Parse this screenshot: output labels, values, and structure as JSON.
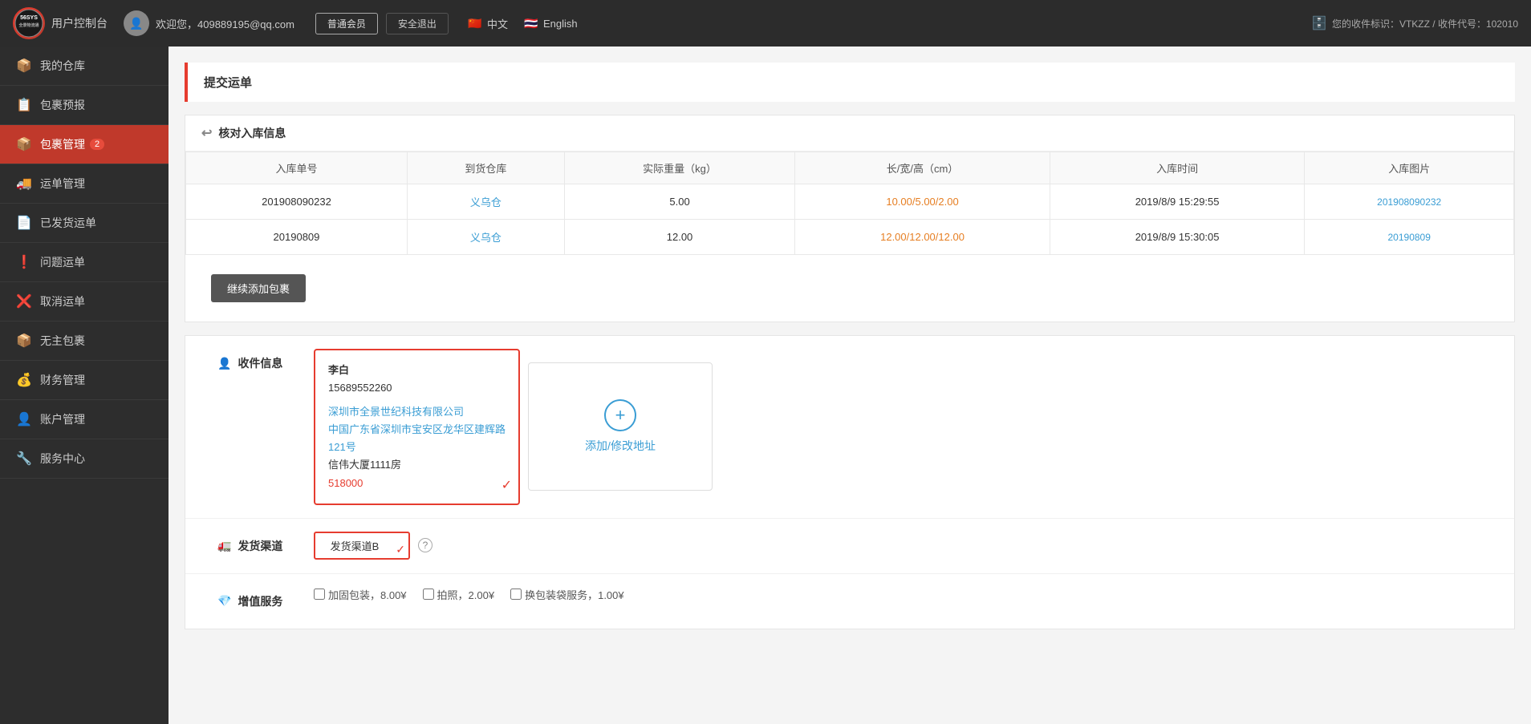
{
  "header": {
    "logo_text": "56SYS",
    "logo_sub": "全景物流通",
    "control_label": "用户控制台",
    "welcome_text": "欢迎您，409889195@qq.com",
    "member_label": "普通会员",
    "logout_label": "安全退出",
    "lang_cn": "中文",
    "lang_en": "English",
    "receipt_label": "您的收件标识：VTKZZ / 收件代号：102010"
  },
  "sidebar": {
    "items": [
      {
        "label": "我的仓库",
        "icon": "📦",
        "active": false
      },
      {
        "label": "包裹预报",
        "icon": "📋",
        "active": false
      },
      {
        "label": "包裹管理",
        "icon": "📦",
        "active": true,
        "badge": "2"
      },
      {
        "label": "运单管理",
        "icon": "🚚",
        "active": false
      },
      {
        "label": "已发货运单",
        "icon": "📄",
        "active": false
      },
      {
        "label": "问题运单",
        "icon": "❗",
        "active": false
      },
      {
        "label": "取消运单",
        "icon": "❌",
        "active": false
      },
      {
        "label": "无主包裹",
        "icon": "📦",
        "active": false
      },
      {
        "label": "财务管理",
        "icon": "💰",
        "active": false
      },
      {
        "label": "账户管理",
        "icon": "👤",
        "active": false
      },
      {
        "label": "服务中心",
        "icon": "🔧",
        "active": false
      }
    ]
  },
  "page": {
    "title": "提交运单",
    "section_verify": "核对入库信息",
    "section_address": "收件信息",
    "section_channel": "发货渠道",
    "section_value": "增值服务"
  },
  "table": {
    "headers": [
      "入库单号",
      "到货仓库",
      "实际重量（kg）",
      "长/宽/高（cm）",
      "入库时间",
      "入库图片"
    ],
    "rows": [
      {
        "order_no": "201908090232",
        "warehouse": "义乌仓",
        "weight": "5.00",
        "dimensions": "10.00/5.00/2.00",
        "time": "2019/8/9 15:29:55",
        "image": "201908090232"
      },
      {
        "order_no": "20190809",
        "warehouse": "义乌仓",
        "weight": "12.00",
        "dimensions": "12.00/12.00/12.00",
        "time": "2019/8/9 15:30:05",
        "image": "20190809"
      }
    ],
    "continue_btn": "继续添加包裹"
  },
  "address": {
    "name": "李白",
    "phone": "15689552260",
    "company": "深圳市全景世纪科技有限公司",
    "address_line1": "中国广东省深圳市宝安区龙华区建辉路",
    "address_line2": "121号",
    "address_line3": "信伟大厦1111房",
    "postcode": "518000",
    "add_label": "添加/修改地址"
  },
  "channel": {
    "selected": "发货渠道B"
  },
  "value_services": [
    {
      "label": "加固包装，8.00¥",
      "checked": false
    },
    {
      "label": "拍照，2.00¥",
      "checked": false
    },
    {
      "label": "换包装袋服务，1.00¥",
      "checked": false
    }
  ]
}
